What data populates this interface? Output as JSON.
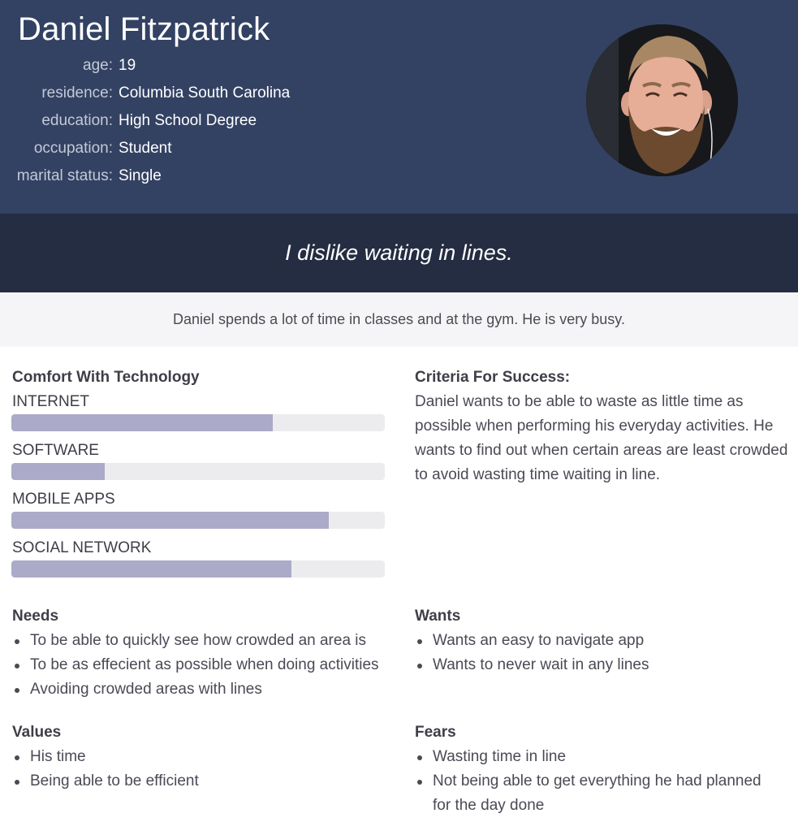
{
  "persona": {
    "name": "Daniel Fitzpatrick",
    "facts": [
      {
        "label": "age:",
        "value": "19"
      },
      {
        "label": "residence:",
        "value": "Columbia South Carolina"
      },
      {
        "label": "education:",
        "value": "High School Degree"
      },
      {
        "label": "occupation:",
        "value": "Student"
      },
      {
        "label": "marital status:",
        "value": "Single"
      }
    ],
    "photo_icon": "person-photo"
  },
  "quote": "I dislike waiting in lines.",
  "bio": "Daniel spends a lot of time in classes and at the gym. He is very busy.",
  "comfort": {
    "title": "Comfort With Technology",
    "items": [
      {
        "label": "INTERNET",
        "level": 0.7
      },
      {
        "label": "SOFTWARE",
        "level": 0.25
      },
      {
        "label": "MOBILE APPS",
        "level": 0.85
      },
      {
        "label": "SOCIAL NETWORK",
        "level": 0.75
      }
    ]
  },
  "criteria": {
    "title": "Criteria For Success:",
    "text": "Daniel wants to be able to waste as little time as possible when performing his everyday activities. He wants to find out when certain areas are least crowded to avoid wasting time waiting in line."
  },
  "needs": {
    "title": "Needs",
    "items": [
      "To be able to quickly see how crowded an area is",
      "To be as effecient as possible when doing activities",
      "Avoiding crowded areas with lines"
    ]
  },
  "wants": {
    "title": "Wants",
    "items": [
      "Wants an easy to navigate app",
      "Wants to never wait in any lines"
    ]
  },
  "values": {
    "title": "Values",
    "items": [
      "His time",
      "Being able to be efficient"
    ]
  },
  "fears": {
    "title": "Fears",
    "items": [
      "Wasting time in line",
      "Not being able to get everything he had planned for the day done"
    ]
  },
  "colors": {
    "header_bg": "#334263",
    "quote_bg": "#242d41",
    "bar_fill": "#abaac8",
    "bar_track": "#ececef"
  }
}
